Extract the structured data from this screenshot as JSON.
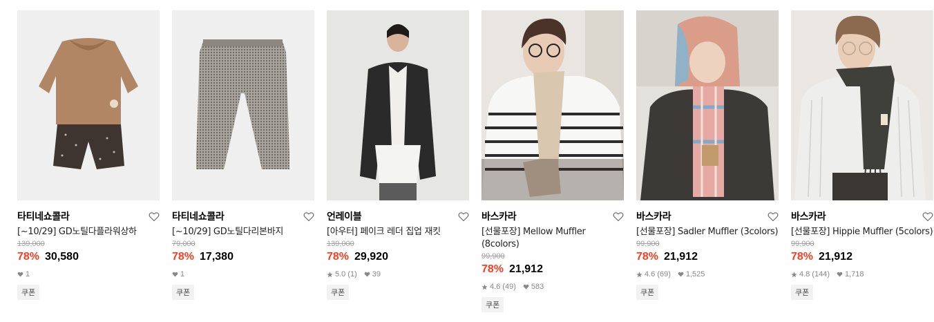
{
  "colors": {
    "discount": "#ff3b1f",
    "meta": "#888888",
    "coupon_bg": "#f2f2f2"
  },
  "products": [
    {
      "brand": "타티네쇼콜라",
      "name": "[~10/29] GD노틸다플라워상하",
      "original_price": "139,000",
      "discount": "78%",
      "price": "30,580",
      "rating": "",
      "reviews": "",
      "likes": "1",
      "coupon": "쿠폰",
      "image": "kids-blouse-and-floral-pants"
    },
    {
      "brand": "타티네쇼콜라",
      "name": "[~10/29] GD노틸다리본바지",
      "original_price": "79,000",
      "discount": "78%",
      "price": "17,380",
      "rating": "",
      "reviews": "",
      "likes": "1",
      "coupon": "쿠폰",
      "image": "houndstooth-pants"
    },
    {
      "brand": "언레이블",
      "name": "[아우터] 페이크 레더 집업 재킷",
      "original_price": "139,000",
      "discount": "78%",
      "price": "29,920",
      "rating": "5.0",
      "reviews": "(1)",
      "likes": "39",
      "coupon": "쿠폰",
      "image": "model-leather-jacket"
    },
    {
      "brand": "바스카라",
      "name": "[선물포장] Mellow Muffler (8colors)",
      "original_price": "99,900",
      "discount": "78%",
      "price": "21,912",
      "rating": "4.6",
      "reviews": "(49)",
      "likes": "583",
      "coupon": "쿠폰",
      "image": "model-beige-muffler"
    },
    {
      "brand": "바스카라",
      "name": "[선물포장] Sadler Muffler (3colors)",
      "original_price": "99,900",
      "discount": "78%",
      "price": "21,912",
      "rating": "4.6",
      "reviews": "(69)",
      "likes": "1,525",
      "coupon": "쿠폰",
      "image": "model-plaid-muffler"
    },
    {
      "brand": "바스카라",
      "name": "[선물포장] Hippie Muffler (5colors)",
      "original_price": "99,900",
      "discount": "78%",
      "price": "21,912",
      "rating": "4.8",
      "reviews": "(144)",
      "likes": "1,718",
      "coupon": "쿠폰",
      "image": "model-charcoal-muffler"
    }
  ]
}
